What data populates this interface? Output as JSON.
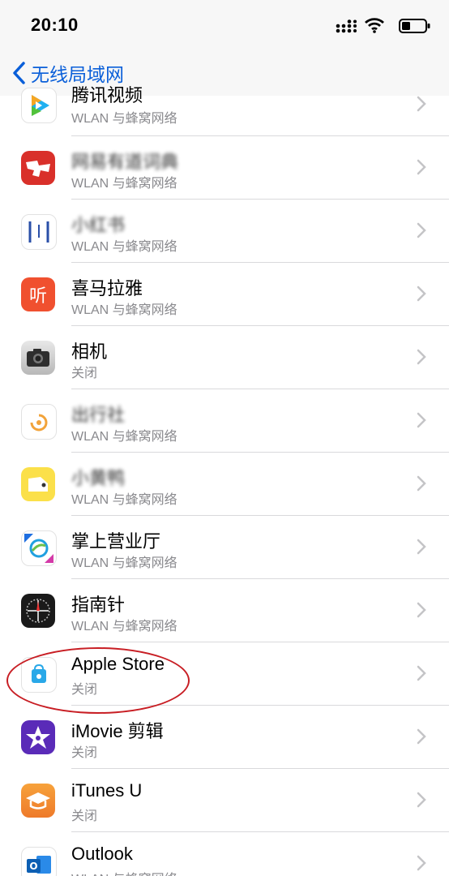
{
  "status_bar": {
    "time": "20:10"
  },
  "nav": {
    "back_label": "无线局域网"
  },
  "apps": [
    {
      "name": "腾讯视频",
      "access": "WLAN 与蜂窝网络",
      "icon": "tencent-video-icon"
    },
    {
      "name": "网易有道词典",
      "access": "WLAN 与蜂窝网络",
      "icon": "dictionary-icon"
    },
    {
      "name": "小红书",
      "access": "WLAN 与蜂窝网络",
      "icon": "app-icon"
    },
    {
      "name": "喜马拉雅",
      "access": "WLAN 与蜂窝网络",
      "icon": "ximalaya-icon"
    },
    {
      "name": "相机",
      "access": "关闭",
      "icon": "camera-icon"
    },
    {
      "name": "出行社",
      "access": "WLAN 与蜂窝网络",
      "icon": "app-icon"
    },
    {
      "name": "小黄鸭",
      "access": "WLAN 与蜂窝网络",
      "icon": "app-icon"
    },
    {
      "name": "掌上营业厅",
      "access": "WLAN 与蜂窝网络",
      "icon": "china-mobile-icon"
    },
    {
      "name": "指南针",
      "access": "WLAN 与蜂窝网络",
      "icon": "compass-icon"
    },
    {
      "name": "Apple Store",
      "access": "关闭",
      "icon": "apple-store-icon"
    },
    {
      "name": "iMovie 剪辑",
      "access": "关闭",
      "icon": "imovie-icon"
    },
    {
      "name": "iTunes U",
      "access": "关闭",
      "icon": "itunes-u-icon"
    },
    {
      "name": "Outlook",
      "access": "WLAN 与蜂窝网络",
      "icon": "outlook-icon"
    }
  ],
  "colors": {
    "accent": "#0a5fd9",
    "highlight": "#c81e24"
  }
}
